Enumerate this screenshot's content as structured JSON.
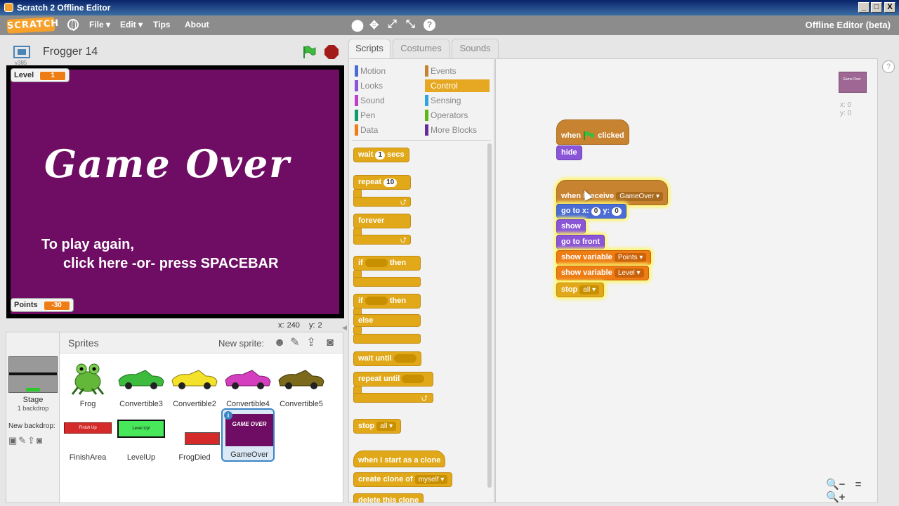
{
  "window": {
    "title": "Scratch 2 Offline Editor",
    "buttons": [
      "_",
      "□",
      "X"
    ]
  },
  "menubar": {
    "logo": "SCRATCH",
    "items": [
      "File ▾",
      "Edit ▾",
      "Tips",
      "About"
    ],
    "tools": [
      "⬤",
      "✥",
      "⤢",
      "⤡"
    ],
    "help": "?",
    "right_label": "Offline Editor (beta)"
  },
  "stage_header": {
    "version": "v385",
    "project_title": "Frogger 14"
  },
  "stage": {
    "game_over_text": "Game Over",
    "line1": "To play again,",
    "line2": "click here   -or-   press SPACEBAR",
    "monitor_level": {
      "label": "Level",
      "value": "1"
    },
    "monitor_points": {
      "label": "Points",
      "value": "-30"
    }
  },
  "coords": {
    "x_label": "x:",
    "x_value": "240",
    "y_label": "y:",
    "y_value": "2"
  },
  "sprites_pane": {
    "header": "Sprites",
    "new_sprite_label": "New sprite:",
    "stage_name": "Stage",
    "backdrop_count": "1 backdrop",
    "new_backdrop_label": "New backdrop:",
    "sprites": [
      {
        "name": "Frog"
      },
      {
        "name": "Convertible3"
      },
      {
        "name": "Convertible2"
      },
      {
        "name": "Convertible4"
      },
      {
        "name": "Convertible5"
      },
      {
        "name": "FinishArea"
      },
      {
        "name": "LevelUp"
      },
      {
        "name": "FrogDied"
      },
      {
        "name": "GameOver"
      }
    ],
    "finish_thumb_text": "Finish Up",
    "levelup_thumb_text": "Level Up!",
    "gameover_thumb_text": "GAME OVER"
  },
  "tabs": [
    "Scripts",
    "Costumes",
    "Sounds"
  ],
  "categories": {
    "left": [
      {
        "label": "Motion",
        "color": "#4a6cd4"
      },
      {
        "label": "Looks",
        "color": "#8a55d7"
      },
      {
        "label": "Sound",
        "color": "#bb42c3"
      },
      {
        "label": "Pen",
        "color": "#0e9a6c"
      },
      {
        "label": "Data",
        "color": "#ee7d16"
      }
    ],
    "right": [
      {
        "label": "Events",
        "color": "#c88330"
      },
      {
        "label": "Control",
        "color": "#e1a91a"
      },
      {
        "label": "Sensing",
        "color": "#2ca5e2"
      },
      {
        "label": "Operators",
        "color": "#5cb712"
      },
      {
        "label": "More Blocks",
        "color": "#632d99"
      }
    ]
  },
  "palette_blocks": {
    "wait": "wait",
    "wait_val": "1",
    "wait_unit": "secs",
    "repeat": "repeat",
    "repeat_val": "10",
    "forever": "forever",
    "if": "if",
    "then": "then",
    "if2": "if",
    "then2": "then",
    "else": "else",
    "wait_until": "wait until",
    "repeat_until": "repeat until",
    "stop": "stop",
    "stop_val": "all",
    "clone_start": "when I start as a clone",
    "create_clone": "create clone of",
    "create_clone_val": "myself",
    "delete_clone": "delete this clone"
  },
  "scripts": {
    "script1": {
      "when": "when",
      "clicked": "clicked",
      "hide": "hide"
    },
    "script2": {
      "when_receive": "when I receive",
      "message": "GameOver",
      "goto": "go to x:",
      "x": "0",
      "y_label": "y:",
      "y": "0",
      "show": "show",
      "go_front": "go to front",
      "show_var1": "show variable",
      "var1": "Points",
      "show_var2": "show variable",
      "var2": "Level",
      "stop": "stop",
      "stop_val": "all"
    },
    "mini_coords": {
      "x": "x: 0",
      "y": "y: 0"
    },
    "mini_sprite_text": "Game Over"
  },
  "zoom": [
    "🔍−",
    "=",
    "🔍+"
  ]
}
